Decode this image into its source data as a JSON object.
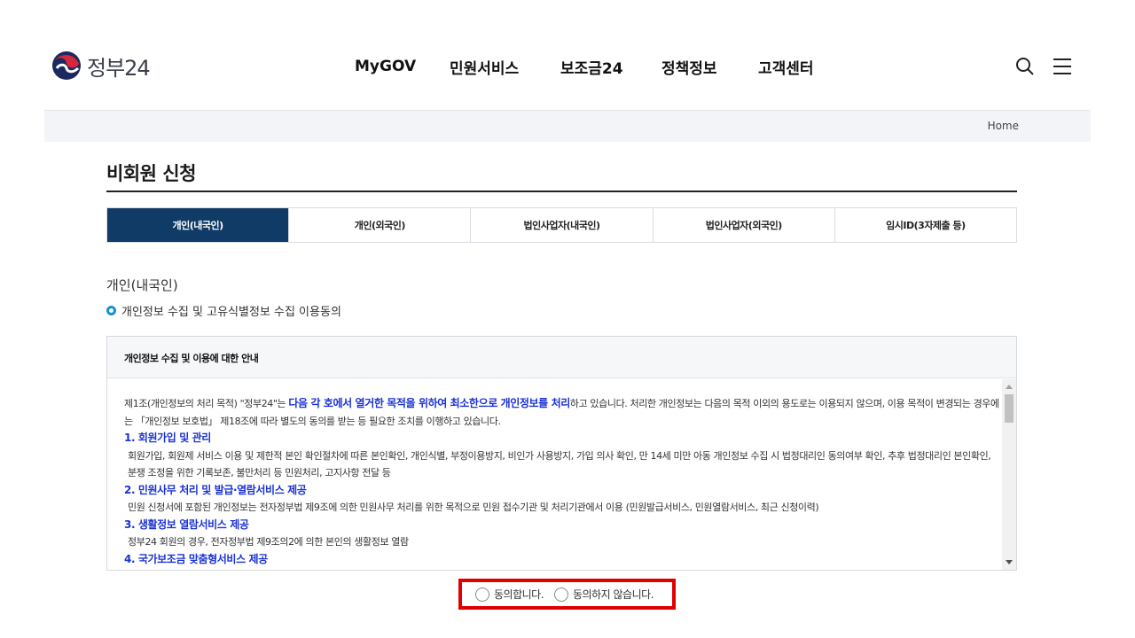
{
  "header": {
    "logo_text": "정부24",
    "nav": [
      "MyGOV",
      "민원서비스",
      "보조금24",
      "정책정보",
      "고객센터"
    ],
    "search_icon": "search-icon",
    "menu_icon": "hamburger-menu-icon"
  },
  "breadcrumb": {
    "home": "Home"
  },
  "page": {
    "title": "비회원 신청",
    "tabs": [
      "개인(내국인)",
      "개인(외국인)",
      "법인사업자(내국인)",
      "법인사업자(외국인)",
      "임시ID(3자제출 등)"
    ],
    "active_tab_index": 0,
    "section_label": "개인(내국인)",
    "section_sub": "개인정보 수집 및 고유식별정보 수집 이용동의"
  },
  "agreement": {
    "heading": "개인정보 수집 및 이용에 대한 안내",
    "intro_pre": "제1조(개인정보의 처리 목적) \"정부24\"는 ",
    "intro_hl": "다음 각 호에서 열거한 목적을 위하여 최소한으로 개인정보를 처리",
    "intro_post": "하고 있습니다. 처리한 개인정보는 다음의 목적 이외의 용도로는 이용되지 않으며, 이용 목적이 변경되는 경우에는 「개인정보 보호법」 제18조에 따라 별도의 동의를 받는 등 필요한 조치를 이행하고 있습니다.",
    "items": [
      {
        "title": "1. 회원가입 및 관리",
        "desc": "회원가입, 회원제 서비스 이용 및 제한적 본인 확인절차에 따른 본인확인, 개인식별, 부정이용방지, 비인가 사용방지, 가입 의사 확인, 만 14세 미만 아동 개인정보 수집 시 법정대리인 동의여부 확인, 추후 법정대리인 본인확인, 분쟁 조정을 위한 기록보존, 불만처리 등 민원처리, 고지사항 전달 등"
      },
      {
        "title": "2. 민원사무 처리 및 발급·열람서비스 제공",
        "desc": "민원 신청서에 포함된 개인정보는 전자정부법 제9조에 의한 민원사무 처리를 위한 목적으로 민원 접수기관 및 처리기관에서 이용 (민원발급서비스, 민원열람서비스, 최근 신청이력)"
      },
      {
        "title": "3. 생활정보 열람서비스 제공",
        "desc": "정부24 회원의 경우, 전자정부법 제9조의2에 의한 본인의 생활정보 열람"
      },
      {
        "title": "4. 국가보조금 맞춤형서비스 제공",
        "desc": ""
      }
    ]
  },
  "consent": {
    "agree": "동의합니다.",
    "disagree": "동의하지 않습니다.",
    "highlight_color": "#e00000"
  },
  "colors": {
    "active_tab": "#103b66",
    "link_blue": "#1a32d6",
    "bullet_blue": "#1a8fd8"
  }
}
